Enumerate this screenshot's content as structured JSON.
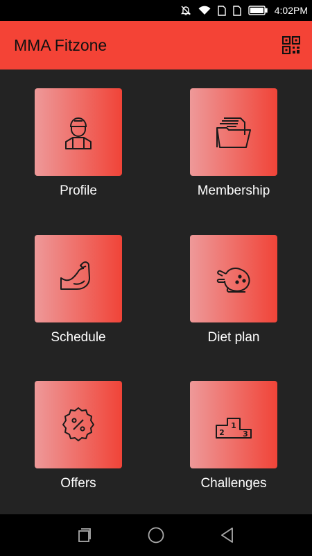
{
  "status_bar": {
    "time": "4:02PM",
    "icons": [
      "notifications-off-icon",
      "wifi-icon",
      "sim-card-icon",
      "sim-card-icon",
      "battery-icon"
    ]
  },
  "app_bar": {
    "title": "MMA Fitzone",
    "qr_icon": "qr-code-icon"
  },
  "tiles": [
    {
      "label": "Profile",
      "icon": "user-icon"
    },
    {
      "label": "Membership",
      "icon": "folder-icon"
    },
    {
      "label": "Schedule",
      "icon": "flexed-arm-icon"
    },
    {
      "label": "Diet plan",
      "icon": "roast-chicken-icon"
    },
    {
      "label": "Offers",
      "icon": "discount-badge-icon"
    },
    {
      "label": "Challenges",
      "icon": "podium-icon"
    }
  ],
  "nav_bar": {
    "icons": [
      "recent-apps-icon",
      "home-icon",
      "back-icon"
    ]
  },
  "colors": {
    "accent": "#f44336",
    "background": "#232323",
    "tile_gradient_start": "#ee9999",
    "tile_gradient_end": "#f04438"
  }
}
